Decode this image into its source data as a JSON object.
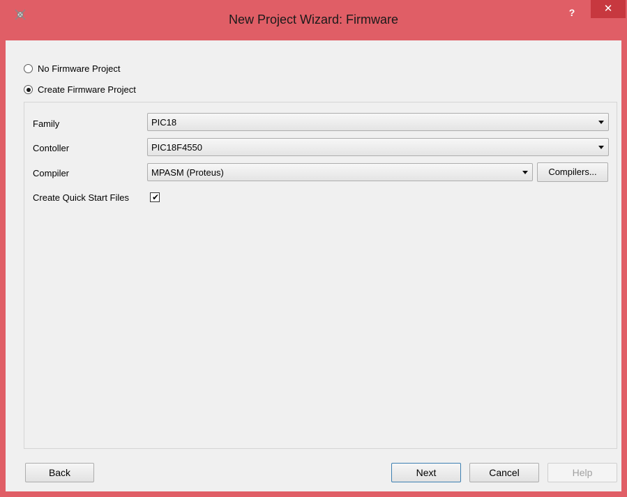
{
  "window": {
    "title": "New Project Wizard: Firmware",
    "help_label": "?",
    "close_label": "✕",
    "colors": {
      "titlebar": "#e05e66",
      "close": "#c7383f",
      "client": "#f0f0f0"
    }
  },
  "options": {
    "no_firmware_label": "No Firmware Project",
    "no_firmware_selected": false,
    "create_firmware_label": "Create Firmware Project",
    "create_firmware_selected": true
  },
  "form": {
    "family_label": "Family",
    "family_value": "PIC18",
    "controller_label": "Contoller",
    "controller_value": "PIC18F4550",
    "compiler_label": "Compiler",
    "compiler_value": "MPASM (Proteus)",
    "compilers_button": "Compilers...",
    "quick_start_label": "Create Quick Start Files",
    "quick_start_checked": true
  },
  "footer": {
    "back_label": "Back",
    "next_label": "Next",
    "cancel_label": "Cancel",
    "help_label": "Help"
  },
  "icons": {
    "app_icon": "proteus-app-icon",
    "check": "✔"
  }
}
